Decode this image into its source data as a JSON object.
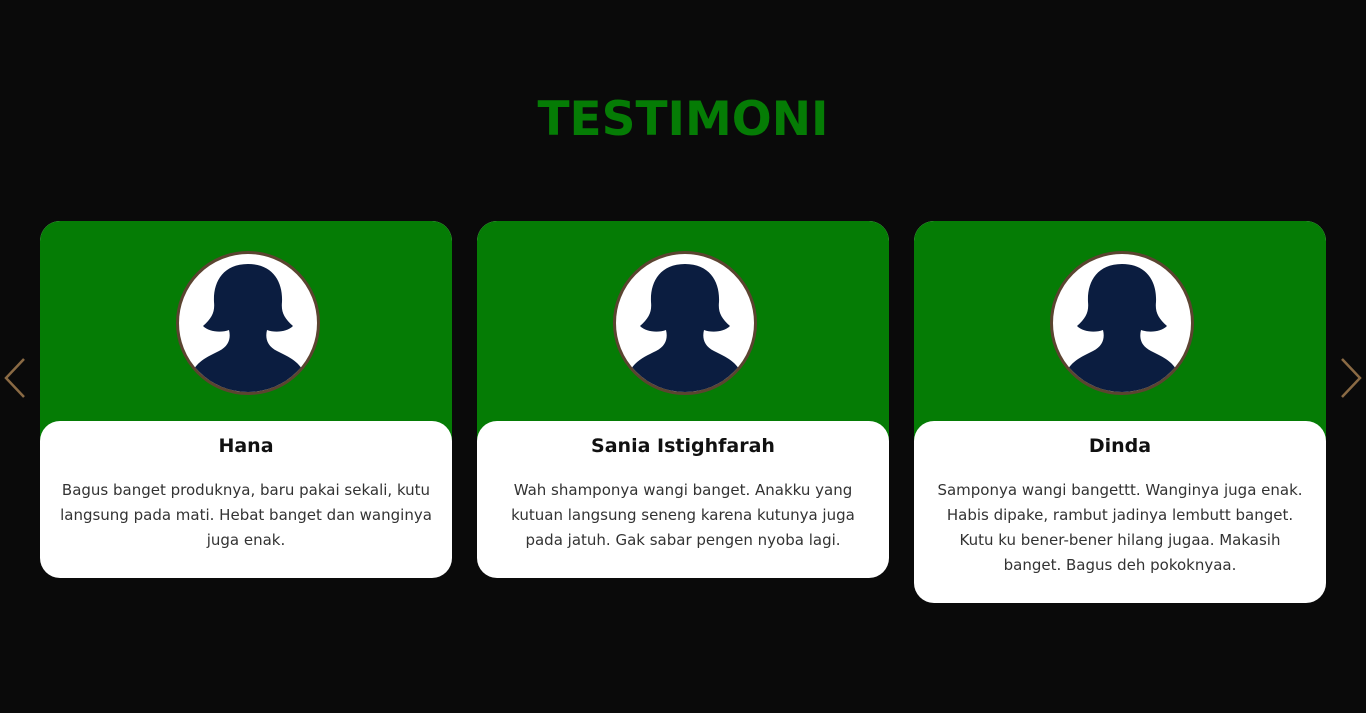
{
  "section": {
    "title": "TESTIMONI"
  },
  "colors": {
    "accent": "#057c05",
    "background": "#0a0a0a",
    "avatar_silhouette": "#0b1d40",
    "avatar_border": "#5b4430",
    "arrow": "#8a6a44"
  },
  "navigation": {
    "prev_icon": "chevron-left-icon",
    "next_icon": "chevron-right-icon"
  },
  "testimonials": [
    {
      "name": "Hana",
      "text": "Bagus banget produknya, baru pakai sekali, kutu langsung pada mati. Hebat banget dan wanginya juga enak.",
      "avatar_icon": "user-silhouette-icon"
    },
    {
      "name": "Sania Istighfarah",
      "text": "Wah shamponya wangi banget. Anakku yang kutuan langsung seneng karena kutunya juga pada jatuh. Gak sabar pengen nyoba lagi.",
      "avatar_icon": "user-silhouette-icon"
    },
    {
      "name": "Dinda",
      "text": "Samponya wangi bangettt. Wanginya juga enak. Habis dipake, rambut jadinya lembutt banget. Kutu ku bener-bener hilang jugaa. Makasih banget. Bagus deh pokoknyaa.",
      "avatar_icon": "user-silhouette-icon"
    }
  ]
}
